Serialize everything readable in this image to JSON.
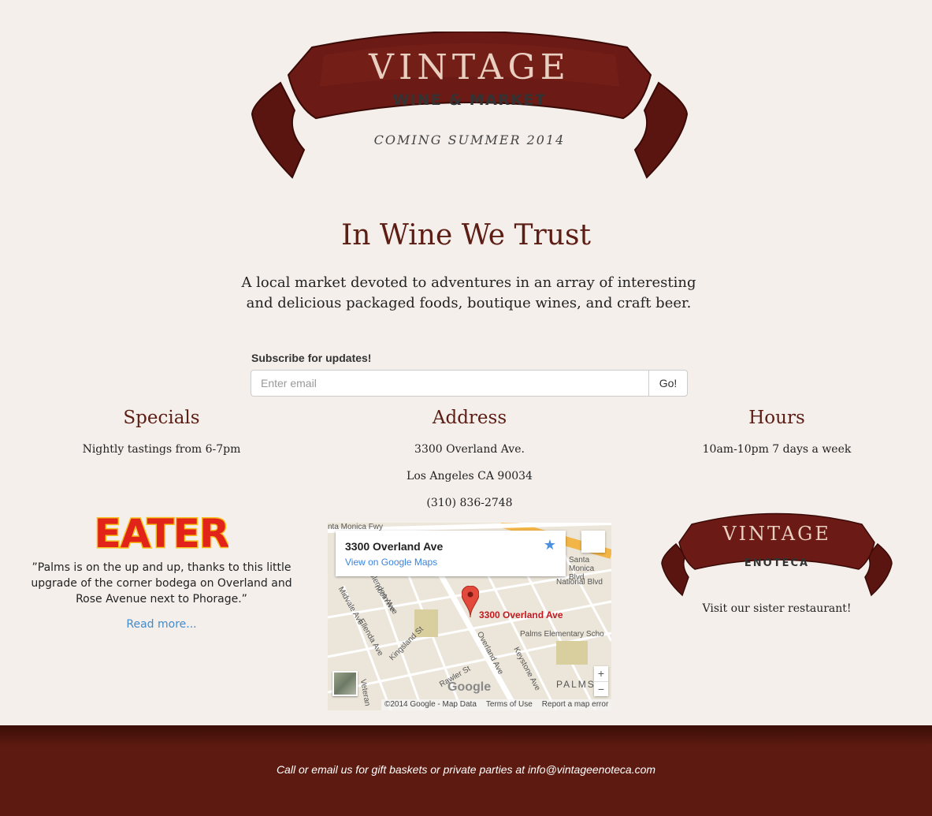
{
  "header": {
    "brand_main": "VINTAGE",
    "brand_sub": "WINE & MARKET",
    "tagline": "COMING SUMMER 2014"
  },
  "hero": {
    "title": "In Wine We Trust",
    "description_line1": "A local market devoted to adventures in an array of interesting",
    "description_line2": "and delicious packaged foods, boutique wines, and craft beer."
  },
  "subscribe": {
    "label": "Subscribe for updates!",
    "placeholder": "Enter email",
    "button": "Go!"
  },
  "specials": {
    "heading": "Specials",
    "text": "Nightly tastings from 6-7pm"
  },
  "address": {
    "heading": "Address",
    "street": "3300 Overland Ave.",
    "city": "Los Angeles CA 90034",
    "phone": "(310) 836-2748"
  },
  "hours": {
    "heading": "Hours",
    "text": "10am-10pm 7 days a week"
  },
  "press": {
    "logo_text": "EATER",
    "quote": "”Palms is on the up and up, thanks to this little upgrade of the corner bodega on Overland and Rose Avenue next to Phorage.”",
    "read_more": "Read more..."
  },
  "map": {
    "card_title": "3300 Overland Ave",
    "card_link": "View on Google Maps",
    "pin_label": "3300 Overland Ave",
    "streets": [
      "nta Monica Fwy",
      "Santa Monica Blvd",
      "National Blvd",
      "Glendon Ave",
      "Midvale Ave",
      "Ellenda Ave",
      "Kingsland St",
      "Overland Ave",
      "Keystone Ave",
      "Palms Elementary Scho",
      "PALMS",
      "Rawler St",
      "ncoln Ave",
      "Veteran"
    ],
    "google_text": "Google",
    "copyright": "©2014 Google - Map Data",
    "terms": "Terms of Use",
    "report": "Report a map error",
    "zoom_in": "+",
    "zoom_out": "−"
  },
  "sister": {
    "logo_main": "VINTAGE",
    "logo_sub": "ENOTECA",
    "text": "Visit our sister restaurant!"
  },
  "footer": {
    "text": "Call or email us for gift baskets or private parties at info@vintageenoteca.com"
  },
  "colors": {
    "brand": "#5c1d14",
    "ribbon": "#6b1a15",
    "link": "#428bca",
    "background": "#f4efeb"
  }
}
